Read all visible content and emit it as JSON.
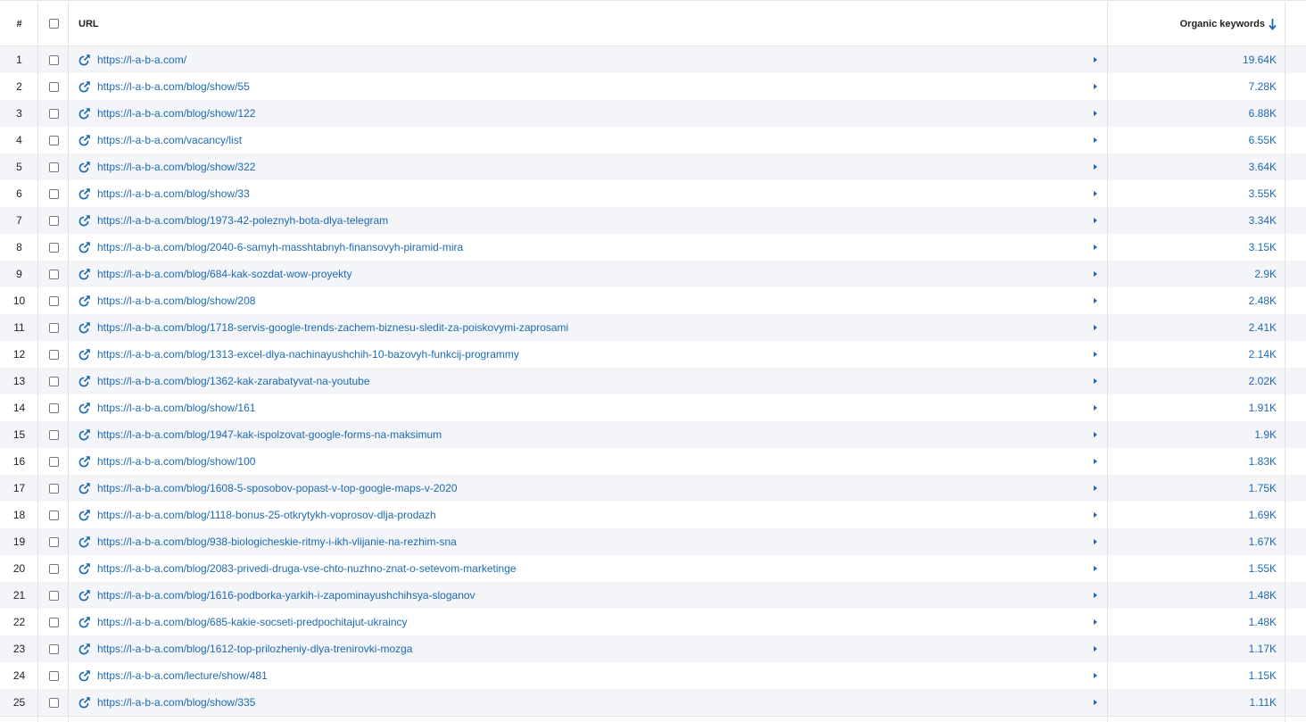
{
  "columns": {
    "num": "#",
    "url": "URL",
    "keywords": "Organic keywords"
  },
  "icons": {
    "sort": "arrow-down-icon",
    "link": "external-link-icon",
    "expand": "triangle-right-icon"
  },
  "colors": {
    "link": "#1d69b5",
    "row_alt": "#f3f5f8"
  },
  "rows": [
    {
      "num": "1",
      "url": "https://l-a-b-a.com/",
      "keywords": "19.64K"
    },
    {
      "num": "2",
      "url": "https://l-a-b-a.com/blog/show/55",
      "keywords": "7.28K"
    },
    {
      "num": "3",
      "url": "https://l-a-b-a.com/blog/show/122",
      "keywords": "6.88K"
    },
    {
      "num": "4",
      "url": "https://l-a-b-a.com/vacancy/list",
      "keywords": "6.55K"
    },
    {
      "num": "5",
      "url": "https://l-a-b-a.com/blog/show/322",
      "keywords": "3.64K"
    },
    {
      "num": "6",
      "url": "https://l-a-b-a.com/blog/show/33",
      "keywords": "3.55K"
    },
    {
      "num": "7",
      "url": "https://l-a-b-a.com/blog/1973-42-poleznyh-bota-dlya-telegram",
      "keywords": "3.34K"
    },
    {
      "num": "8",
      "url": "https://l-a-b-a.com/blog/2040-6-samyh-masshtabnyh-finansovyh-piramid-mira",
      "keywords": "3.15K"
    },
    {
      "num": "9",
      "url": "https://l-a-b-a.com/blog/684-kak-sozdat-wow-proyekty",
      "keywords": "2.9K"
    },
    {
      "num": "10",
      "url": "https://l-a-b-a.com/blog/show/208",
      "keywords": "2.48K"
    },
    {
      "num": "11",
      "url": "https://l-a-b-a.com/blog/1718-servis-google-trends-zachem-biznesu-sledit-za-poiskovymi-zaprosami",
      "keywords": "2.41K"
    },
    {
      "num": "12",
      "url": "https://l-a-b-a.com/blog/1313-excel-dlya-nachinayushchih-10-bazovyh-funkcij-programmy",
      "keywords": "2.14K"
    },
    {
      "num": "13",
      "url": "https://l-a-b-a.com/blog/1362-kak-zarabatyvat-na-youtube",
      "keywords": "2.02K"
    },
    {
      "num": "14",
      "url": "https://l-a-b-a.com/blog/show/161",
      "keywords": "1.91K"
    },
    {
      "num": "15",
      "url": "https://l-a-b-a.com/blog/1947-kak-ispolzovat-google-forms-na-maksimum",
      "keywords": "1.9K"
    },
    {
      "num": "16",
      "url": "https://l-a-b-a.com/blog/show/100",
      "keywords": "1.83K"
    },
    {
      "num": "17",
      "url": "https://l-a-b-a.com/blog/1608-5-sposobov-popast-v-top-google-maps-v-2020",
      "keywords": "1.75K"
    },
    {
      "num": "18",
      "url": "https://l-a-b-a.com/blog/1118-bonus-25-otkrytykh-voprosov-dlja-prodazh",
      "keywords": "1.69K"
    },
    {
      "num": "19",
      "url": "https://l-a-b-a.com/blog/938-biologicheskie-ritmy-i-ikh-vlijanie-na-rezhim-sna",
      "keywords": "1.67K"
    },
    {
      "num": "20",
      "url": "https://l-a-b-a.com/blog/2083-privedi-druga-vse-chto-nuzhno-znat-o-setevom-marketinge",
      "keywords": "1.55K"
    },
    {
      "num": "21",
      "url": "https://l-a-b-a.com/blog/1616-podborka-yarkih-i-zapominayushchihsya-sloganov",
      "keywords": "1.48K"
    },
    {
      "num": "22",
      "url": "https://l-a-b-a.com/blog/685-kakie-socseti-predpochitajut-ukraincy",
      "keywords": "1.48K"
    },
    {
      "num": "23",
      "url": "https://l-a-b-a.com/blog/1612-top-prilozheniy-dlya-trenirovki-mozga",
      "keywords": "1.17K"
    },
    {
      "num": "24",
      "url": "https://l-a-b-a.com/lecture/show/481",
      "keywords": "1.15K"
    },
    {
      "num": "25",
      "url": "https://l-a-b-a.com/blog/show/335",
      "keywords": "1.11K"
    }
  ]
}
